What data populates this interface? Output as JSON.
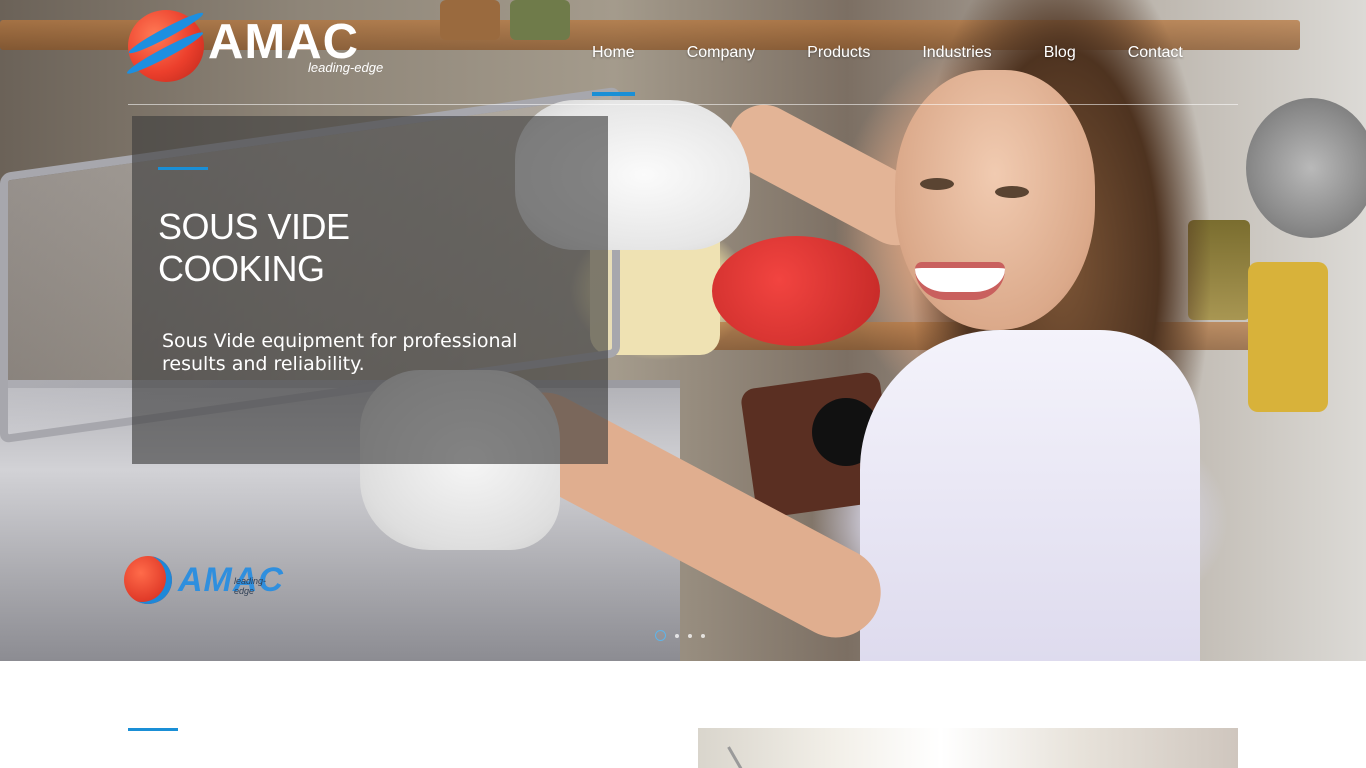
{
  "brand": {
    "name": "AMAC",
    "tagline": "leading-edge"
  },
  "nav": {
    "items": [
      {
        "label": "Home",
        "active": true
      },
      {
        "label": "Company",
        "active": false
      },
      {
        "label": "Products",
        "active": false
      },
      {
        "label": "Industries",
        "active": false
      },
      {
        "label": "Blog",
        "active": false
      },
      {
        "label": "Contact",
        "active": false
      }
    ]
  },
  "hero": {
    "title_line1": "SOUS VIDE",
    "title_line2": "COOKING",
    "subtitle": "Sous Vide equipment for professional results and reliability.",
    "machine_brand": "AMAC",
    "machine_tagline": "leading-edge",
    "slides": [
      {
        "active": true
      },
      {
        "active": false
      },
      {
        "active": false
      },
      {
        "active": false
      }
    ]
  },
  "colors": {
    "accent": "#1a8fd6",
    "caption_bg": "rgba(60,60,60,0.62)",
    "logo_red": "#ec3f2c",
    "logo_blue": "#1d8fe0"
  }
}
